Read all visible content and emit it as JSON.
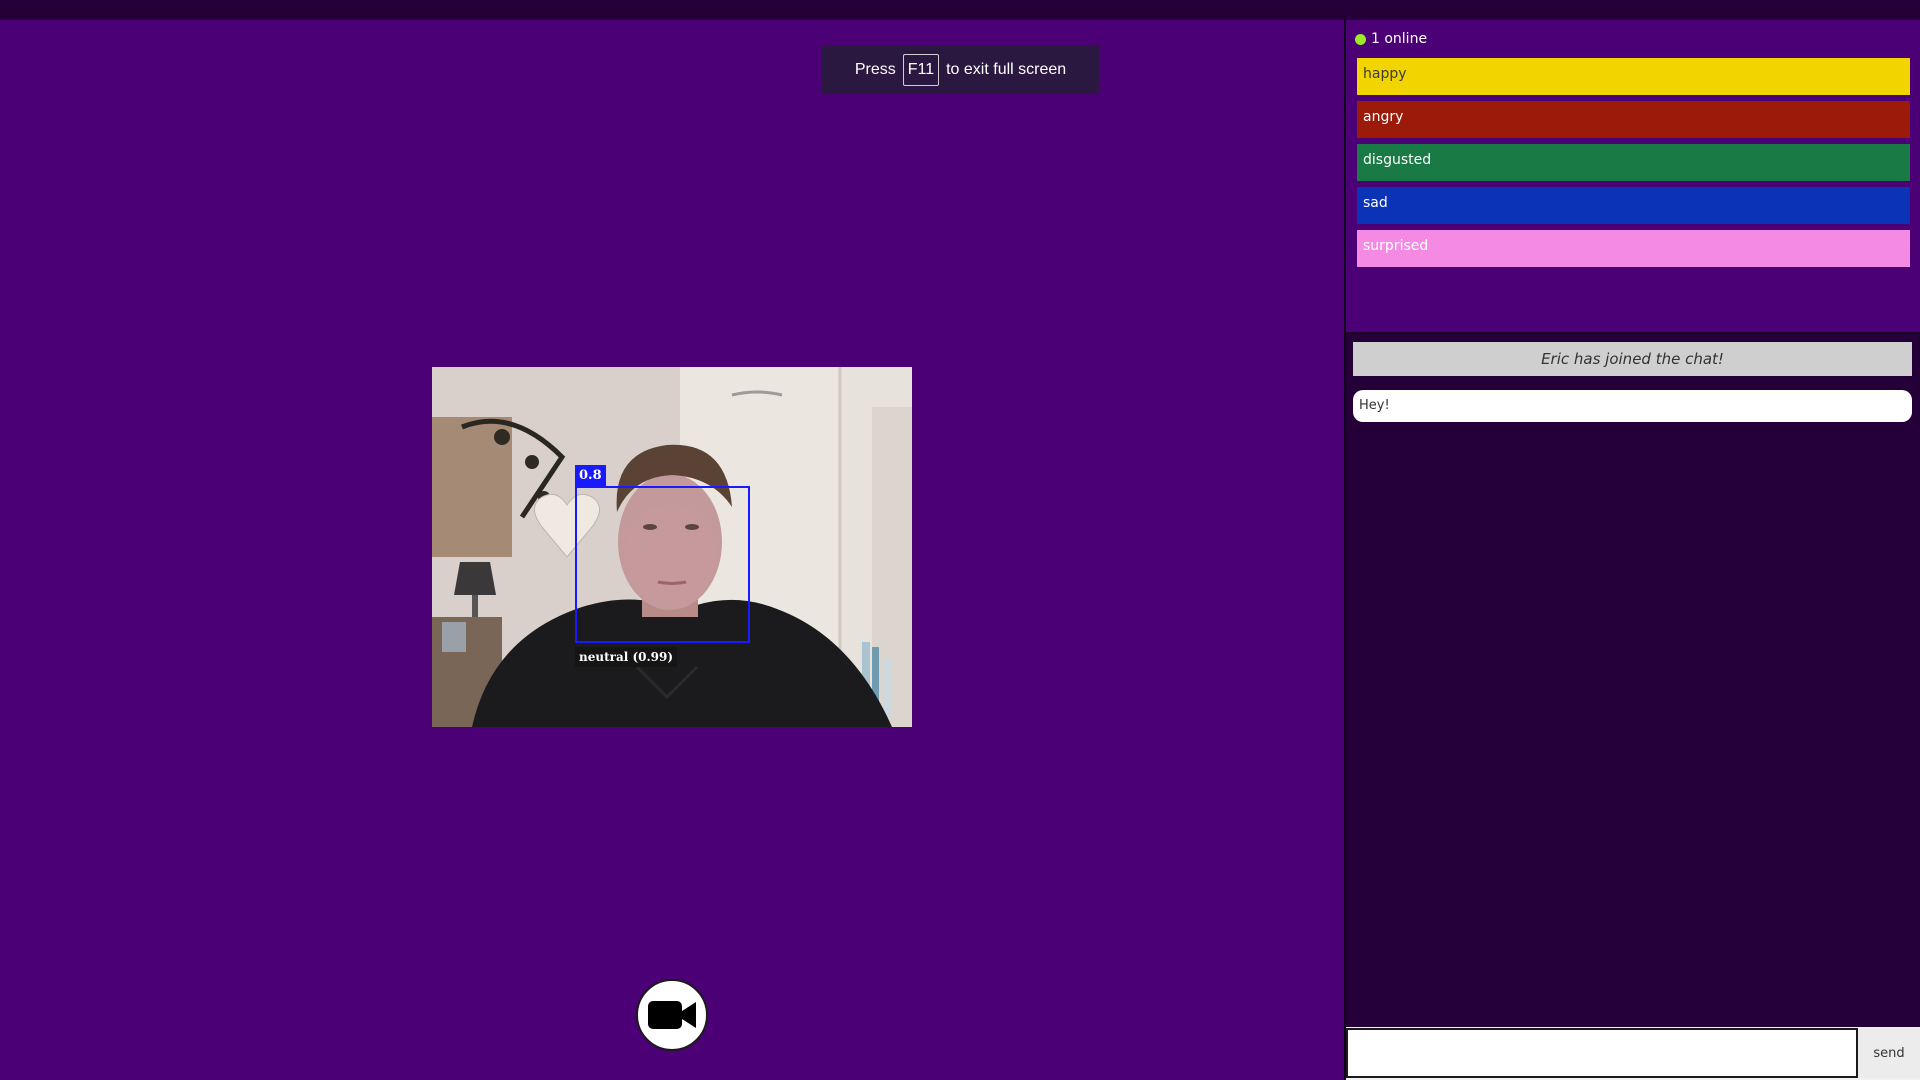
{
  "fullscreen_notice": {
    "prefix": "Press",
    "key": "F11",
    "suffix": "to exit full screen"
  },
  "video": {
    "detection_score": "0.8",
    "expression_label": "neutral (0.99)"
  },
  "sidebar": {
    "online_text": "1 online",
    "online_color": "#9ee82c",
    "emotions": [
      {
        "label": "happy",
        "color": "#f2d500",
        "text_color": "#3b3b3b"
      },
      {
        "label": "angry",
        "color": "#9c1a0a",
        "text_color": "#ffffff"
      },
      {
        "label": "disgusted",
        "color": "#1a7a45",
        "text_color": "#ffffff"
      },
      {
        "label": "sad",
        "color": "#0a33b8",
        "text_color": "#ffffff"
      },
      {
        "label": "surprised",
        "color": "#f48ae4",
        "text_color": "#ffffff"
      }
    ]
  },
  "chat": {
    "join_message": "Eric has joined the chat!",
    "messages": [
      {
        "text": "Hey!"
      }
    ],
    "input_placeholder": "",
    "send_label": "send"
  },
  "icons": {
    "camera_button": "video-camera-icon",
    "online_status": "online-dot-icon"
  },
  "colors": {
    "background": "#4b0076",
    "sidebar": "#250038",
    "face_box": "#1a1aff"
  }
}
